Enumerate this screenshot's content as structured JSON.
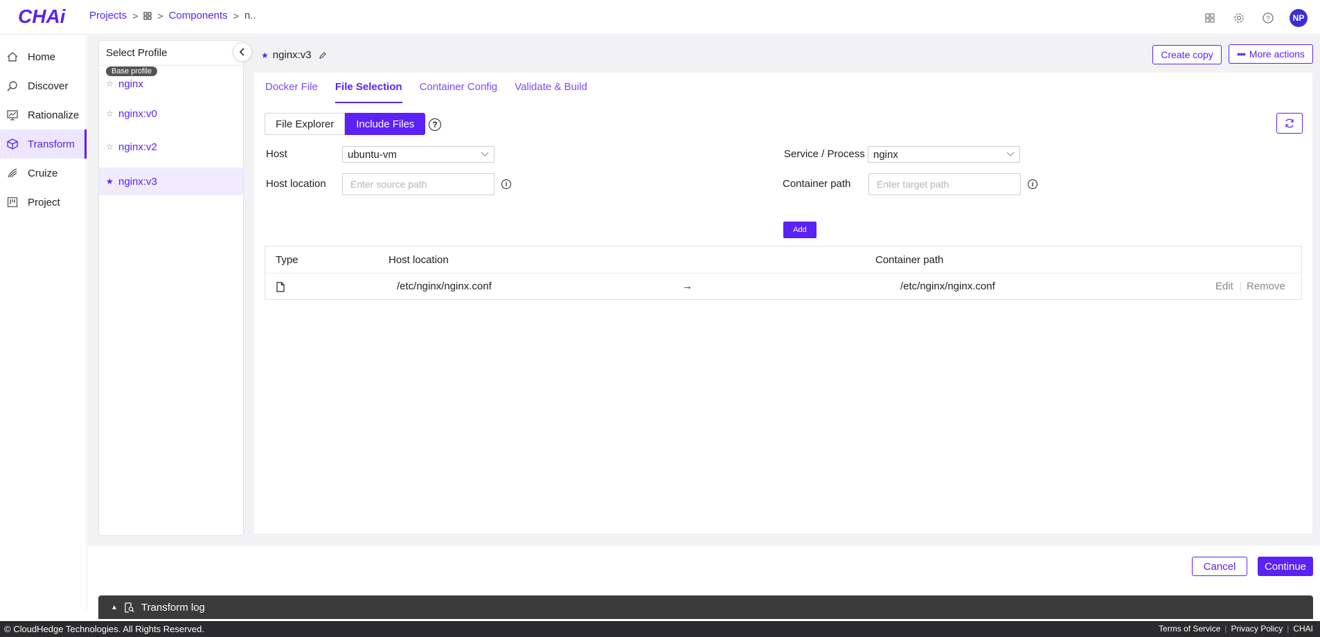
{
  "brand": {
    "logo": "CHAi"
  },
  "breadcrumb": {
    "projects": "Projects",
    "components": "Components",
    "current": "n.."
  },
  "nav": {
    "items": [
      {
        "label": "Home",
        "icon": "home-icon"
      },
      {
        "label": "Discover",
        "icon": "discover-icon"
      },
      {
        "label": "Rationalize",
        "icon": "rationalize-icon"
      },
      {
        "label": "Transform",
        "icon": "transform-icon",
        "active": true
      },
      {
        "label": "Cruize",
        "icon": "cruize-icon"
      },
      {
        "label": "Project",
        "icon": "project-icon"
      }
    ]
  },
  "user": {
    "initials": "NP"
  },
  "profiles": {
    "title": "Select Profile",
    "base_badge": "Base profile",
    "items": [
      {
        "label": "nginx"
      },
      {
        "label": "nginx:v0"
      },
      {
        "label": "nginx:v2"
      },
      {
        "label": "nginx:v3",
        "active": true
      }
    ]
  },
  "content": {
    "title": "nginx:v3",
    "create_copy": "Create copy",
    "more_actions": "More actions",
    "tabs": [
      "Docker File",
      "File Selection",
      "Container Config",
      "Validate & Build"
    ],
    "active_tab": "File Selection",
    "mode": {
      "explorer": "File Explorer",
      "include": "Include Files",
      "help": "?"
    },
    "form": {
      "host_label": "Host",
      "host_value": "ubuntu-vm",
      "service_label": "Service / Process",
      "service_value": "nginx",
      "host_location_label": "Host location",
      "host_location_placeholder": "Enter source path",
      "container_path_label": "Container path",
      "container_path_placeholder": "Enter target path",
      "add": "Add"
    },
    "table": {
      "headers": {
        "type": "Type",
        "host": "Host location",
        "container": "Container path"
      },
      "rows": [
        {
          "host": "/etc/nginx/nginx.conf",
          "arrow": "→",
          "container": "/etc/nginx/nginx.conf",
          "edit": "Edit",
          "remove": "Remove"
        }
      ]
    }
  },
  "actions": {
    "cancel": "Cancel",
    "continue": "Continue"
  },
  "log": {
    "label": "Transform log"
  },
  "footer": {
    "copyright": "© CloudHedge Technologies. All Rights Reserved.",
    "terms": "Terms of Service",
    "privacy": "Privacy Policy",
    "brand": "CHAI"
  },
  "colors": {
    "accent": "#5b21f5",
    "log_bg": "#3b3b3d",
    "footer_bg": "#2b2b2d"
  }
}
